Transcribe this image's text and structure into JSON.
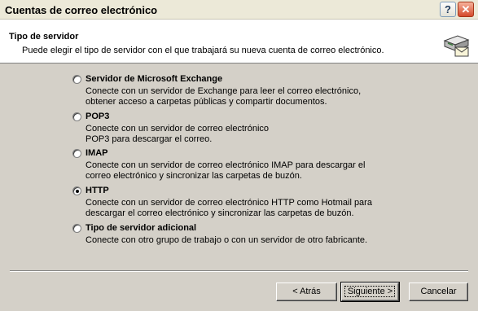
{
  "window": {
    "title": "Cuentas de correo electrónico",
    "help_label": "?",
    "close_label": "✕"
  },
  "header": {
    "title": "Tipo de servidor",
    "subtitle": "Puede elegir el tipo de servidor con el que trabajará su nueva cuenta de correo electrónico.",
    "icon": "mail-server-icon"
  },
  "options": [
    {
      "label": "Servidor de Microsoft Exchange",
      "desc1": "Conecte con un servidor de Exchange para leer el correo electrónico,",
      "desc2": "obtener acceso a carpetas públicas y compartir documentos.",
      "selected": false
    },
    {
      "label": "POP3",
      "desc1": "Conecte con un servidor de correo electrónico",
      "desc2": "POP3 para descargar el correo.",
      "selected": false
    },
    {
      "label": "IMAP",
      "desc1": "Conecte con un servidor de correo electrónico IMAP para descargar el",
      "desc2": "correo electrónico y sincronizar las carpetas de buzón.",
      "selected": false
    },
    {
      "label": "HTTP",
      "desc1": "Conecte con un servidor de correo electrónico HTTP como Hotmail para",
      "desc2": "descargar el correo electrónico y sincronizar las carpetas de buzón.",
      "selected": true
    },
    {
      "label": "Tipo de servidor adicional",
      "desc1": "Conecte con otro grupo de trabajo o con un servidor de otro fabricante.",
      "desc2": "",
      "selected": false
    }
  ],
  "buttons": {
    "back": "< Atrás",
    "next": "Siguiente >",
    "cancel": "Cancelar"
  }
}
